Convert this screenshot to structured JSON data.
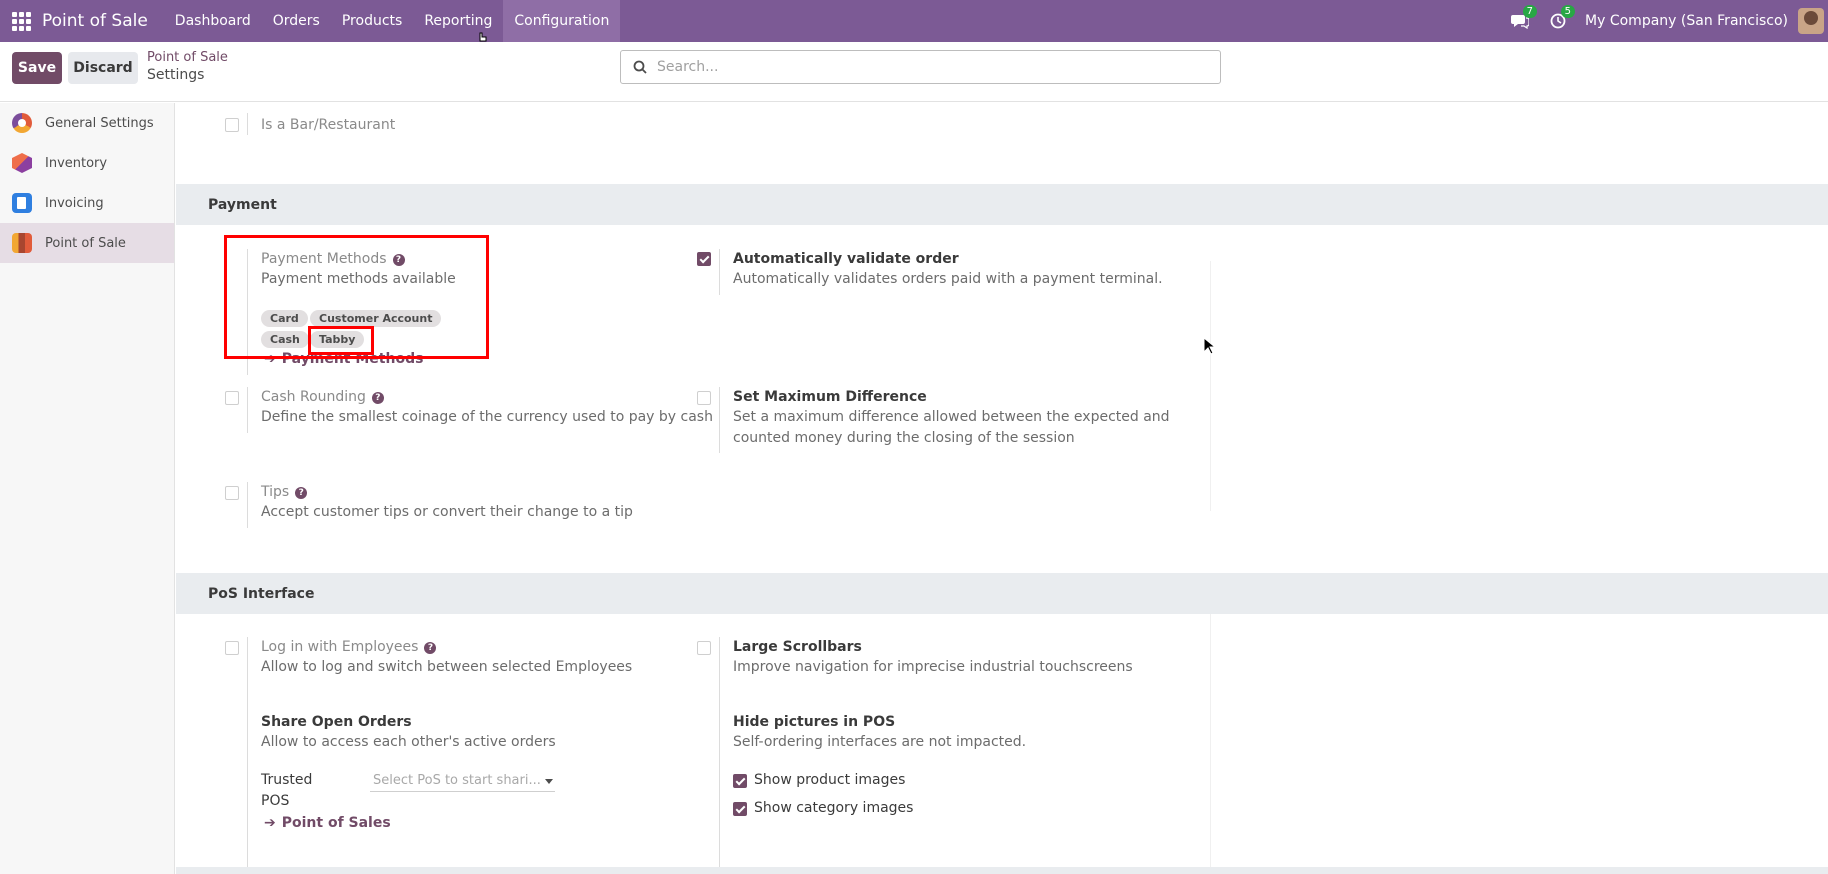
{
  "navbar": {
    "app_name": "Point of Sale",
    "menu": [
      {
        "label": "Dashboard"
      },
      {
        "label": "Orders"
      },
      {
        "label": "Products"
      },
      {
        "label": "Reporting"
      },
      {
        "label": "Configuration"
      }
    ],
    "messages_count": "7",
    "activities_count": "5",
    "company": "My Company (San Francisco)"
  },
  "control": {
    "save_label": "Save",
    "discard_label": "Discard",
    "breadcrumb_parent": "Point of Sale",
    "breadcrumb_current": "Settings",
    "search_placeholder": "Search..."
  },
  "sidebar": {
    "items": [
      {
        "label": "General Settings",
        "icon": "general-settings-icon"
      },
      {
        "label": "Inventory",
        "icon": "inventory-icon"
      },
      {
        "label": "Invoicing",
        "icon": "invoicing-icon"
      },
      {
        "label": "Point of Sale",
        "icon": "point-of-sale-icon",
        "active": true
      }
    ]
  },
  "main": {
    "bar_restaurant": {
      "label": "Is a Bar/Restaurant",
      "checked": false
    },
    "payment": {
      "section_title": "Payment",
      "payment_methods": {
        "title": "Payment Methods",
        "description": "Payment methods available",
        "tags": [
          "Card",
          "Customer Account",
          "Cash",
          "Tabby"
        ],
        "link": "Payment Methods"
      },
      "auto_validate": {
        "title": "Automatically validate order",
        "description": "Automatically validates orders paid with a payment terminal.",
        "checked": true
      },
      "cash_rounding": {
        "title": "Cash Rounding",
        "description": "Define the smallest coinage of the currency used to pay by cash",
        "checked": false
      },
      "max_difference": {
        "title": "Set Maximum Difference",
        "description_1": "Set a maximum difference allowed between the expected and",
        "description_2": "counted money during the closing of the session",
        "checked": false
      },
      "tips": {
        "title": "Tips",
        "description": "Accept customer tips or convert their change to a tip",
        "checked": false
      }
    },
    "pos_interface": {
      "section_title": "PoS Interface",
      "employees": {
        "title": "Log in with Employees",
        "description": "Allow to log and switch between selected Employees",
        "checked": false
      },
      "scrollbars": {
        "title": "Large Scrollbars",
        "description": "Improve navigation for imprecise industrial touchscreens",
        "checked": false
      },
      "share_orders": {
        "title": "Share Open Orders",
        "description": "Allow to access each other's active orders",
        "trusted_label_1": "Trusted",
        "trusted_label_2": "POS",
        "select_placeholder": "Select PoS to start shari...",
        "link": "Point of Sales"
      },
      "hide_pictures": {
        "title": "Hide pictures in POS",
        "description": "Self-ordering interfaces are not impacted.",
        "show_product_images": "Show product images",
        "show_category_images": "Show category images"
      }
    }
  },
  "colors": {
    "navbar": "#7c5a95",
    "primary": "#714b67",
    "highlight": "#ff0000",
    "badge": "#28a745"
  }
}
